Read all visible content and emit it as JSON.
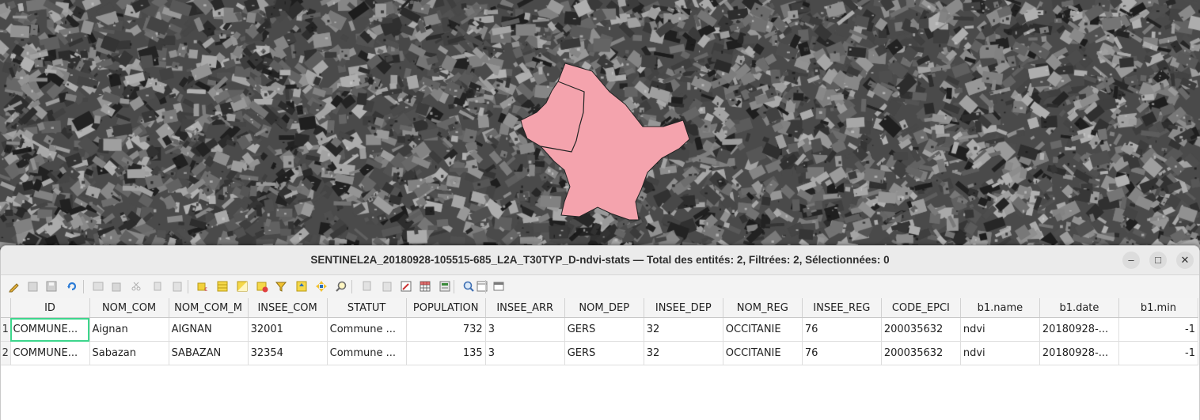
{
  "window": {
    "title": "SENTINEL2A_20180928-105515-685_L2A_T30TYP_D-ndvi-stats — Total des entités: 2, Filtrées: 2, Sélectionnées: 0",
    "minimize_glyph": "–",
    "maximize_glyph": "□",
    "close_glyph": "✕"
  },
  "map": {
    "polygon_fill": "#f4a3ad",
    "polygon_stroke": "#232323"
  },
  "toolbar_icons": [
    "toggle-editing-icon",
    "toggle-multi-edit-icon",
    "save-edits-icon",
    "reload-table-icon",
    "add-feature-icon",
    "delete-feature-icon",
    "cut-icon",
    "copy-icon",
    "paste-icon",
    "select-by-expression-icon",
    "select-all-icon",
    "invert-selection-icon",
    "deselect-all-icon",
    "filter-select-icon",
    "move-selection-top-icon",
    "pan-to-selection-icon",
    "zoom-to-selection-icon",
    "copy-rows-icon",
    "paste-rows-icon",
    "new-field-icon",
    "delete-field-icon",
    "field-calculator-icon",
    "conditional-formatting-icon",
    "actions-icon",
    "dock-table-icon"
  ],
  "table": {
    "columns": [
      "ID",
      "NOM_COM",
      "NOM_COM_M",
      "INSEE_COM",
      "STATUT",
      "POPULATION",
      "INSEE_ARR",
      "NOM_DEP",
      "INSEE_DEP",
      "NOM_REG",
      "INSEE_REG",
      "CODE_EPCI",
      "b1.name",
      "b1.date",
      "b1.min"
    ],
    "rows": [
      {
        "n": "1",
        "cells": [
          "COMMUNE...",
          "Aignan",
          "AIGNAN",
          "32001",
          "Commune ...",
          "732",
          "3",
          "GERS",
          "32",
          "OCCITANIE",
          "76",
          "200035632",
          "ndvi",
          "20180928-...",
          "-1"
        ]
      },
      {
        "n": "2",
        "cells": [
          "COMMUNE...",
          "Sabazan",
          "SABAZAN",
          "32354",
          "Commune ...",
          "135",
          "3",
          "GERS",
          "32",
          "OCCITANIE",
          "76",
          "200035632",
          "ndvi",
          "20180928-...",
          "-1"
        ]
      }
    ]
  }
}
